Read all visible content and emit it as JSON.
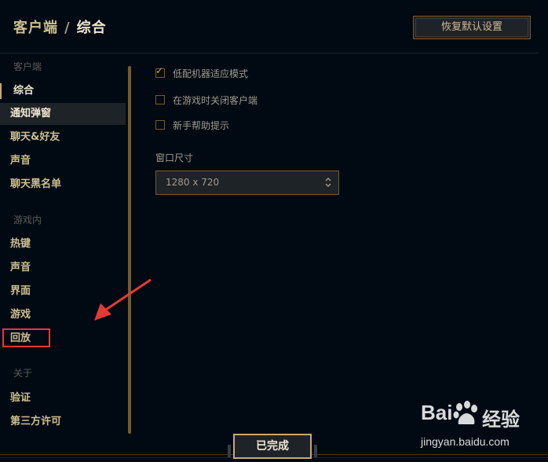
{
  "header": {
    "breadcrumb_parent": "客户端",
    "breadcrumb_separator": "/",
    "breadcrumb_current": "综合",
    "restore_button": "恢复默认设置"
  },
  "sidebar": {
    "section_client": "客户端",
    "client_items": [
      "综合",
      "通知弹窗",
      "聊天&好友",
      "声音",
      "聊天黑名单"
    ],
    "selected_item": "综合",
    "hovered_item": "通知弹窗",
    "section_ingame": "游戏内",
    "ingame_items": [
      "热键",
      "声音",
      "界面",
      "游戏",
      "回放"
    ],
    "highlighted_item": "回放",
    "section_about": "关于",
    "about_items": [
      "验证",
      "第三方许可"
    ]
  },
  "general": {
    "options": [
      {
        "label": "低配机器适应模式",
        "checked": true
      },
      {
        "label": "在游戏时关闭客户端",
        "checked": false
      },
      {
        "label": "新手帮助提示",
        "checked": false
      }
    ],
    "window_size_label": "窗口尺寸",
    "window_size_value": "1280 x 720"
  },
  "footer": {
    "done_button": "已完成"
  },
  "watermark": {
    "logo": "Bai",
    "logo_suffix": "经验",
    "url": "jingyan.baidu.com"
  },
  "colors": {
    "background": "#010a13",
    "gold": "#c8aa6e",
    "gold_dark": "#785a28",
    "text": "#a09b8c",
    "annotation_red": "#e53935"
  },
  "icons": [
    "checkmark-icon",
    "dropdown-updown-icon",
    "annotation-arrow-icon",
    "baidu-paw-icon"
  ]
}
